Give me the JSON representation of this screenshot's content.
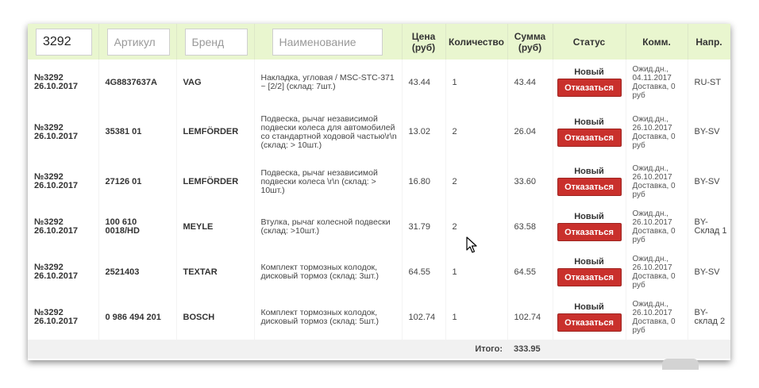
{
  "filters": {
    "order_value": "3292",
    "article_placeholder": "Артикул",
    "brand_placeholder": "Бренд",
    "name_placeholder": "Наименование"
  },
  "headers": {
    "price": "Цена (руб)",
    "quantity": "Количество",
    "sum": "Сумма (руб)",
    "status": "Статус",
    "comment": "Комм.",
    "direction": "Напр."
  },
  "cancel_label": "Отказаться",
  "rows": [
    {
      "order": "№3292",
      "date": "26.10.2017",
      "article": "4G8837637A",
      "brand": "VAG",
      "name": "Накладка, угловая / MSC-STC-371 ~ [2/2] (склад: 7шт.)",
      "price": "43.44",
      "qty": "1",
      "sum": "43.44",
      "status": "Новый",
      "comment": "Ожид.дн., 04.11.2017 Доставка, 0 руб",
      "direction": "RU-ST"
    },
    {
      "order": "№3292",
      "date": "26.10.2017",
      "article": "35381 01",
      "brand": "LEMFÖRDER",
      "name": "Подвеска, рычаг независимой подвески колеса для автомобилей со стандартной ходовой частью\\r\\n (склад: > 10шт.)",
      "price": "13.02",
      "qty": "2",
      "sum": "26.04",
      "status": "Новый",
      "comment": "Ожид.дн., 26.10.2017 Доставка, 0 руб",
      "direction": "BY-SV"
    },
    {
      "order": "№3292",
      "date": "26.10.2017",
      "article": "27126 01",
      "brand": "LEMFÖRDER",
      "name": "Подвеска, рычаг независимой подвески колеса \\r\\n (склад: > 10шт.)",
      "price": "16.80",
      "qty": "2",
      "sum": "33.60",
      "status": "Новый",
      "comment": "Ожид.дн., 26.10.2017 Доставка, 0 руб",
      "direction": "BY-SV"
    },
    {
      "order": "№3292",
      "date": "26.10.2017",
      "article": "100 610 0018/HD",
      "brand": "MEYLE",
      "name": "Втулка, рычаг колесной подвески (склад: >10шт.)",
      "price": "31.79",
      "qty": "2",
      "sum": "63.58",
      "status": "Новый",
      "comment": "Ожид.дн., 26.10.2017 Доставка, 0 руб",
      "direction": "BY-Склад 1"
    },
    {
      "order": "№3292",
      "date": "26.10.2017",
      "article": "2521403",
      "brand": "TEXTAR",
      "name": "Комплект тормозных колодок, дисковый тормоз (склад: 3шт.)",
      "price": "64.55",
      "qty": "1",
      "sum": "64.55",
      "status": "Новый",
      "comment": "Ожид.дн., 26.10.2017 Доставка, 0 руб",
      "direction": "BY-SV"
    },
    {
      "order": "№3292",
      "date": "26.10.2017",
      "article": "0 986 494 201",
      "brand": "BOSCH",
      "name": "Комплект тормозных колодок, дисковый тормоз (склад: 5шт.)",
      "price": "102.74",
      "qty": "1",
      "sum": "102.74",
      "status": "Новый",
      "comment": "Ожид.дн., 26.10.2017 Доставка, 0 руб",
      "direction": "BY-склад 2"
    }
  ],
  "footer": {
    "total_label": "Итого:",
    "total_value": "333.95"
  },
  "colors": {
    "header_bg": "#e9f6cf",
    "cancel_button": "#c9302c",
    "footer_bg": "#f1f1f1"
  }
}
